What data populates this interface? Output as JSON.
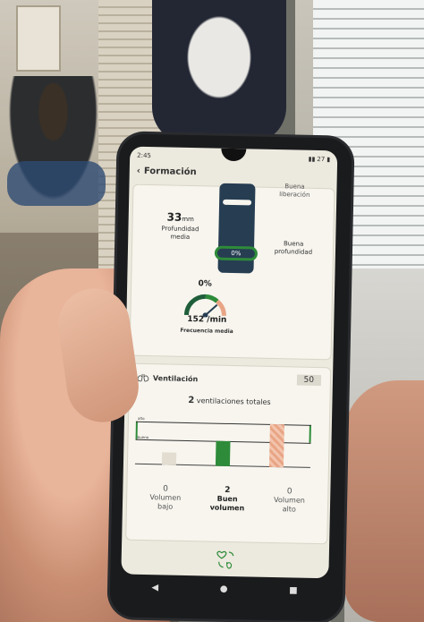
{
  "status_bar": {
    "time": "2:45",
    "battery": "27"
  },
  "header": {
    "back_icon": "chevron-left-icon",
    "title": "Formación"
  },
  "compression": {
    "depth_value": "33",
    "depth_unit": "mm",
    "depth_label_1": "Profundidad",
    "depth_label_2": "media",
    "gauge_value": "0%",
    "release_label_1": "Buena",
    "release_label_2": "liberación",
    "good_depth_label_1": "Buena",
    "good_depth_label_2": "profundidad",
    "rate_percent": "0%",
    "rate_value": "152 /min",
    "rate_label": "Frecuencia media"
  },
  "ventilation": {
    "title": "Ventilación",
    "count_badge": "50",
    "total_number": "2",
    "total_label": "ventilaciones totales",
    "axis_high": "alto",
    "axis_good": "bueno",
    "chart_data": {
      "type": "bar",
      "categories": [
        "Volumen bajo",
        "Buen volumen",
        "Volumen alto"
      ],
      "values": [
        0,
        2,
        0
      ],
      "colors": [
        "#e2ddd0",
        "#2e8b3a",
        "#e8a585"
      ]
    },
    "categories": [
      {
        "count": "0",
        "line1": "Volumen",
        "line2": "bajo"
      },
      {
        "count": "2",
        "line1": "Buen",
        "line2": "volumen"
      },
      {
        "count": "0",
        "line1": "Volumen",
        "line2": "alto"
      }
    ]
  },
  "colors": {
    "accent": "#2e8b3a",
    "navy": "#263d52",
    "high": "#e8a585"
  },
  "navbar": {
    "back": "◀",
    "home": "●",
    "recent": "■"
  }
}
